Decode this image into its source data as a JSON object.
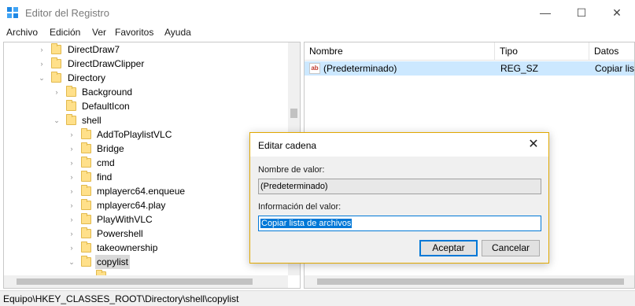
{
  "window": {
    "title": "Editor del Registro",
    "minimize_glyph": "—",
    "maximize_glyph": "☐",
    "close_glyph": "✕"
  },
  "menu": [
    "Archivo",
    "Edición",
    "Ver",
    "Favoritos",
    "Ayuda"
  ],
  "tree": {
    "items": [
      {
        "label": "DirectDraw7",
        "arrow": "›"
      },
      {
        "label": "DirectDrawClipper",
        "arrow": "›"
      },
      {
        "label": "Directory",
        "arrow": "⌄"
      },
      {
        "label": "Background",
        "arrow": "›"
      },
      {
        "label": "DefaultIcon",
        "arrow": ""
      },
      {
        "label": "shell",
        "arrow": "⌄"
      },
      {
        "label": "AddToPlaylistVLC",
        "arrow": "›"
      },
      {
        "label": "Bridge",
        "arrow": "›"
      },
      {
        "label": "cmd",
        "arrow": "›"
      },
      {
        "label": "find",
        "arrow": "›"
      },
      {
        "label": "mplayerc64.enqueue",
        "arrow": "›"
      },
      {
        "label": "mplayerc64.play",
        "arrow": "›"
      },
      {
        "label": "PlayWithVLC",
        "arrow": "›"
      },
      {
        "label": "Powershell",
        "arrow": "›"
      },
      {
        "label": "takeownership",
        "arrow": "›"
      },
      {
        "label": "copylist",
        "arrow": "⌄"
      }
    ]
  },
  "list": {
    "columns": [
      "Nombre",
      "Tipo",
      "Datos"
    ],
    "rows": [
      {
        "icon": "ab",
        "name": "(Predeterminado)",
        "type": "REG_SZ",
        "data": "Copiar lis"
      }
    ]
  },
  "status": {
    "path": "Equipo\\HKEY_CLASSES_ROOT\\Directory\\shell\\copylist"
  },
  "dialog": {
    "title": "Editar cadena",
    "close_glyph": "✕",
    "name_label": "Nombre de valor:",
    "name_value": "(Predeterminado)",
    "data_label": "Información del valor:",
    "data_value": "Copiar lista de archivos",
    "ok_label": "Aceptar",
    "cancel_label": "Cancelar"
  },
  "colors": {
    "selection": "#cce8ff",
    "dialog_border": "#e0a800",
    "accent": "#0078d7",
    "folder": "#ffe08a"
  }
}
